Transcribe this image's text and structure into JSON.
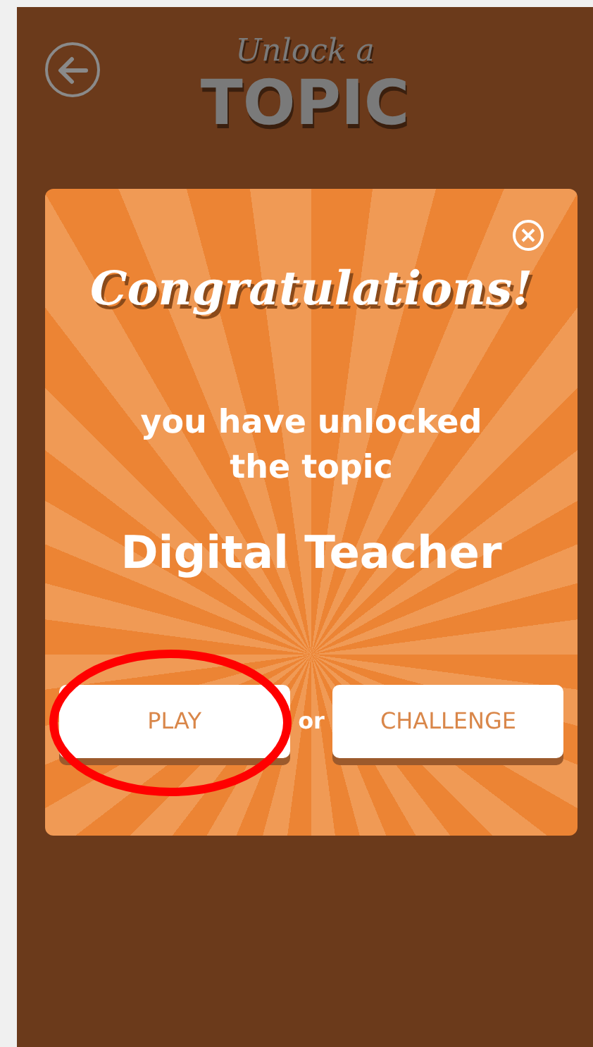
{
  "header": {
    "subtitle": "Unlock a",
    "title": "TOPIC"
  },
  "dialog": {
    "heading": "Congratulations!",
    "message": "you have unlocked the topic",
    "topic": "Digital Teacher",
    "buttons": [
      {
        "label": "PLAY",
        "highlighted": true
      },
      {
        "label": "CHALLENGE",
        "highlighted": false
      }
    ],
    "separator": "or"
  }
}
